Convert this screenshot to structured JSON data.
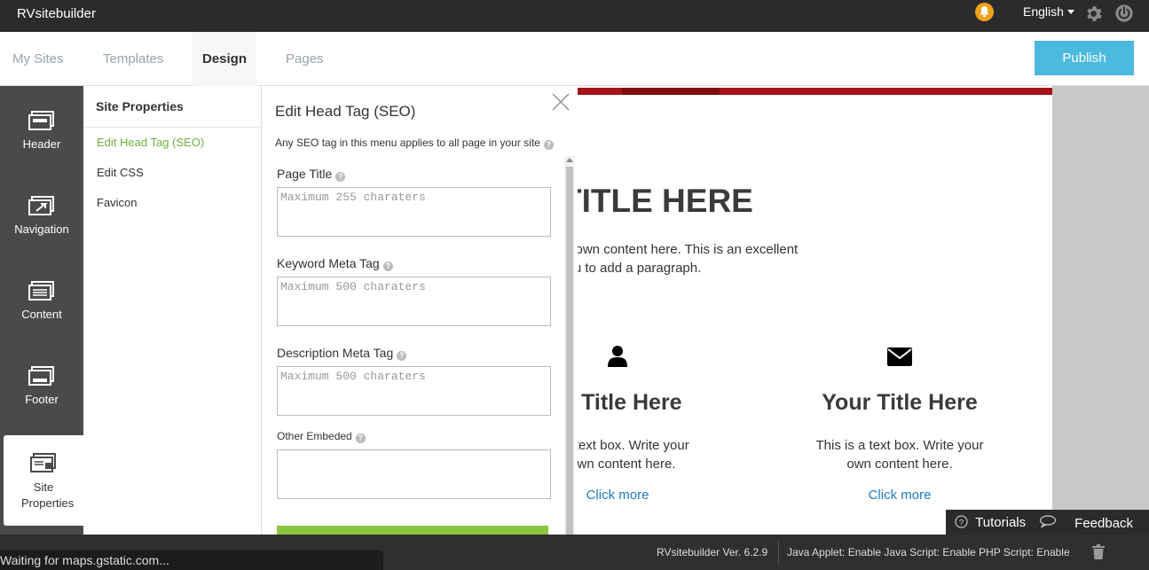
{
  "topbar": {
    "brand": "RVsitebuilder",
    "language": "English",
    "icons": [
      "bell-icon",
      "gear-icon",
      "power-icon"
    ],
    "accent_bell": "#f0a21b"
  },
  "nav": {
    "tabs": [
      {
        "label": "My Sites",
        "active": false
      },
      {
        "label": "Templates",
        "active": false
      },
      {
        "label": "Design",
        "active": true
      },
      {
        "label": "Pages",
        "active": false
      }
    ],
    "publish_label": "Publish",
    "publish_color": "#4cb9df"
  },
  "sidebar": {
    "items": [
      {
        "label": "Header",
        "icon": "header-icon"
      },
      {
        "label": "Navigation",
        "icon": "navigation-icon"
      },
      {
        "label": "Content",
        "icon": "content-icon"
      },
      {
        "label": "Footer",
        "icon": "footer-icon"
      },
      {
        "label": "Site Properties",
        "icon": "site-properties-icon",
        "active": true
      }
    ]
  },
  "properties_menu": {
    "title": "Site Properties",
    "items": [
      {
        "label": "Edit Head Tag (SEO)",
        "active": true
      },
      {
        "label": "Edit CSS"
      },
      {
        "label": "Favicon"
      }
    ]
  },
  "seo_panel": {
    "title": "Edit Head Tag (SEO)",
    "hint": "Any SEO tag in this menu applies to all page in your site",
    "fields": [
      {
        "label": "Page Title",
        "placeholder": "Maximum 255 charaters"
      },
      {
        "label": "Keyword Meta Tag",
        "placeholder": "Maximum 500 charaters"
      },
      {
        "label": "Description Meta Tag",
        "placeholder": "Maximum 500 charaters"
      },
      {
        "label": "Other Embeded",
        "placeholder": ""
      }
    ]
  },
  "preview": {
    "title": "TITLE HERE",
    "para_line1": "ur own content here. This is an excellent",
    "para_line2": "you to add a paragraph.",
    "columns": [
      {
        "icon": "user-icon",
        "title": "r Title Here",
        "text1": "a text box. Write your",
        "text2": "wn content here.",
        "link": "Click more"
      },
      {
        "icon": "envelope-icon",
        "title": "Your Title Here",
        "text1": "This is a text box. Write your",
        "text2": "own content here.",
        "link": "Click more"
      }
    ],
    "accent_red": "#a31318"
  },
  "help_bar": {
    "tutorials": "Tutorials",
    "feedback": "Feedback"
  },
  "status": {
    "loading": "Waiting for maps.gstatic.com...",
    "version": "RVsitebuilder Ver. 6.2.9",
    "scripts": "Java Applet: Enable Java Script: Enable PHP Script: Enable"
  }
}
